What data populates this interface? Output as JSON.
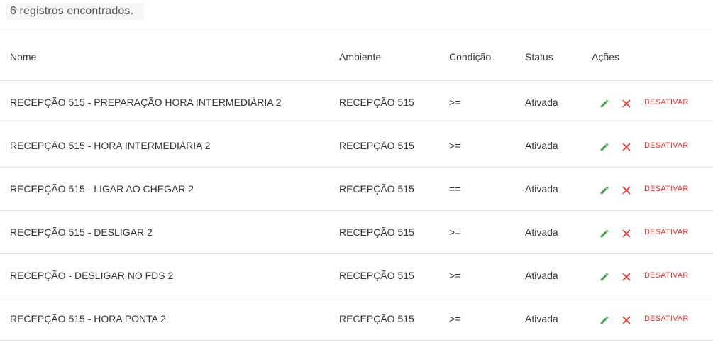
{
  "summary": {
    "count_text": "6 registros encontrados."
  },
  "table": {
    "headers": {
      "name": "Nome",
      "environment": "Ambiente",
      "condition": "Condição",
      "status": "Status",
      "actions": "Ações"
    },
    "rows": [
      {
        "name": "RECEPÇÃO 515 - PREPARAÇÃO HORA INTERMEDIÁRIA 2",
        "environment": "RECEPÇÃO 515",
        "condition": ">=",
        "status": "Ativada",
        "action_label": "DESATIVAR"
      },
      {
        "name": "RECEPÇÃO 515 - HORA INTERMEDIÁRIA 2",
        "environment": "RECEPÇÃO 515",
        "condition": ">=",
        "status": "Ativada",
        "action_label": "DESATIVAR"
      },
      {
        "name": "RECEPÇÃO 515 - LIGAR AO CHEGAR 2",
        "environment": "RECEPÇÃO 515",
        "condition": "==",
        "status": "Ativada",
        "action_label": "DESATIVAR"
      },
      {
        "name": "RECEPÇÃO 515 - DESLIGAR 2",
        "environment": "RECEPÇÃO 515",
        "condition": ">=",
        "status": "Ativada",
        "action_label": "DESATIVAR"
      },
      {
        "name": "RECEPÇÃO - DESLIGAR NO FDS 2",
        "environment": "RECEPÇÃO 515",
        "condition": ">=",
        "status": "Ativada",
        "action_label": "DESATIVAR"
      },
      {
        "name": "RECEPÇÃO 515 - HORA PONTA 2",
        "environment": "RECEPÇÃO 515",
        "condition": ">=",
        "status": "Ativada",
        "action_label": "DESATIVAR"
      }
    ]
  },
  "icons": {
    "edit": "pencil-icon",
    "delete": "close-icon"
  },
  "colors": {
    "edit_icon": "#43a047",
    "delete_icon": "#e53935",
    "deactivate_text": "#e53935",
    "row_divider": "#e2e2e2"
  }
}
